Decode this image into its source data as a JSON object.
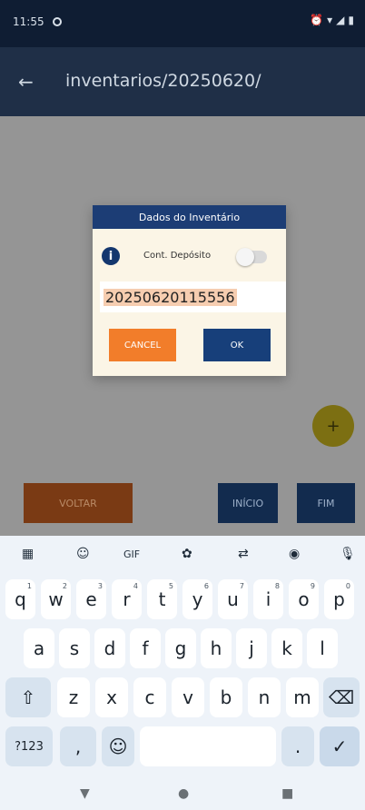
{
  "status_bar": {
    "time": "11:55",
    "right_icons": [
      "alarm-icon",
      "wifi-icon",
      "signal-icon",
      "battery-icon"
    ]
  },
  "app_bar": {
    "back_icon": "←",
    "title": "inventarios/20250620/"
  },
  "fab": {
    "label": "+"
  },
  "bottom_buttons": {
    "voltar": "VOLTAR",
    "inicio": "INÍCIO",
    "fim": "FIM"
  },
  "dialog": {
    "title": "Dados do Inventário",
    "info_icon": "i",
    "cont_label": "Cont. Depósito",
    "toggle_on": false,
    "field_value": "20250620115556",
    "cancel": "CANCEL",
    "ok": "OK"
  },
  "keyboard": {
    "toolbar": [
      "apps-icon",
      "sticker-icon",
      "GIF",
      "settings-icon",
      "translate-icon",
      "palette-icon",
      "mic-icon"
    ],
    "toolbar_gif": "GIF",
    "row1": [
      "q",
      "w",
      "e",
      "r",
      "t",
      "y",
      "u",
      "i",
      "o",
      "p"
    ],
    "row1_hints": [
      "1",
      "2",
      "3",
      "4",
      "5",
      "6",
      "7",
      "8",
      "9",
      "0"
    ],
    "row2": [
      "a",
      "s",
      "d",
      "f",
      "g",
      "h",
      "j",
      "k",
      "l"
    ],
    "row3": [
      "z",
      "x",
      "c",
      "v",
      "b",
      "n",
      "m"
    ],
    "shift": "⇧",
    "backspace": "⌫",
    "symbols": "?123",
    "comma": ",",
    "emoji": "☺",
    "period": ".",
    "enter": "✓"
  },
  "nav_bar": {
    "back": "▼",
    "home": "●",
    "recents": "■"
  },
  "colors": {
    "status_bar": "#0f1d33",
    "app_bar": "#1f2f47",
    "dialog_header": "#1c3d75",
    "cancel": "#f27d2a",
    "ok": "#173f7a"
  }
}
